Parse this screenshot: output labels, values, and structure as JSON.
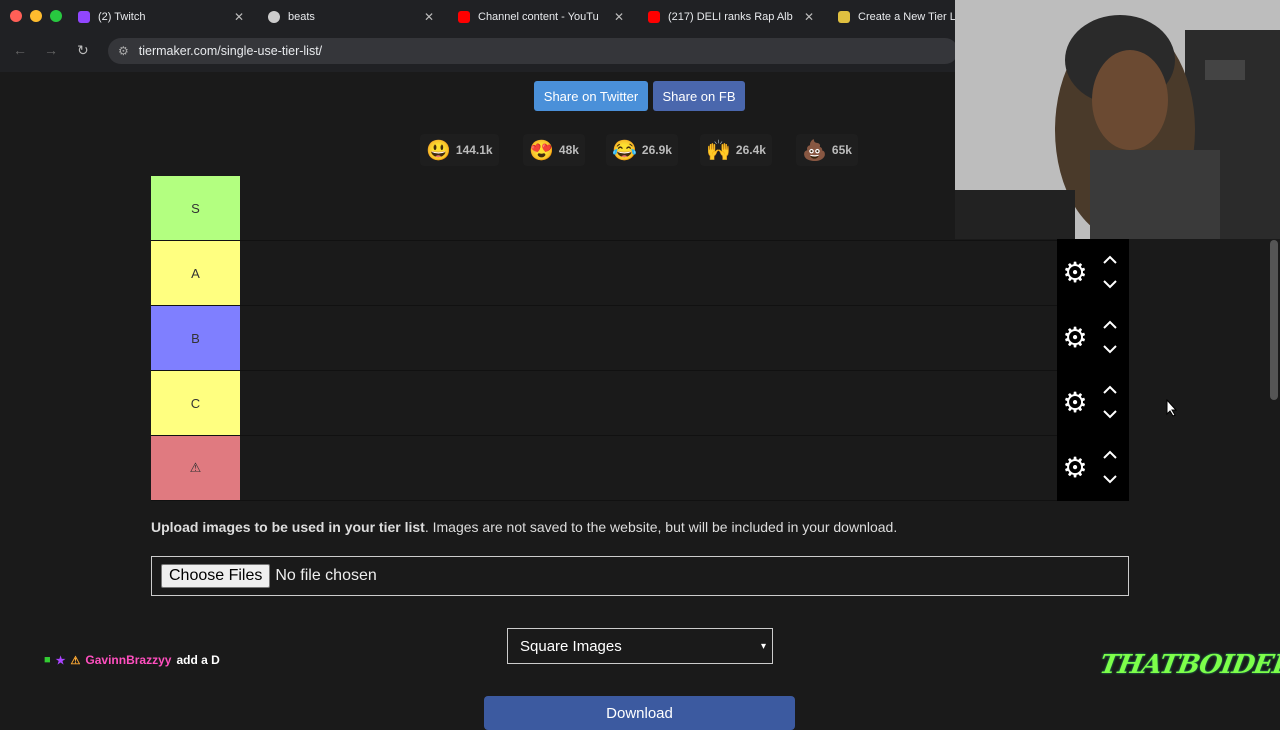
{
  "tabs": [
    {
      "label": "(2) Twitch",
      "icon": "twitch-icon",
      "color": "#9146ff"
    },
    {
      "label": "beats",
      "icon": "disc-icon",
      "color": "#cccccc"
    },
    {
      "label": "Channel content - YouTu",
      "icon": "youtube-icon",
      "color": "#ff0000"
    },
    {
      "label": "(217) DELI ranks Rap Alb",
      "icon": "youtube-icon",
      "color": "#ff0000"
    },
    {
      "label": "Create a New Tier L",
      "icon": "tiermaker-icon",
      "color": "#e0c040"
    }
  ],
  "address": "tiermaker.com/single-use-tier-list/",
  "share": {
    "twitter": "Share on Twitter",
    "fb": "Share on FB"
  },
  "reactions": [
    {
      "emoji": "😃",
      "count": "144.1k"
    },
    {
      "emoji": "😍",
      "count": "48k"
    },
    {
      "emoji": "😂",
      "count": "26.9k"
    },
    {
      "emoji": "🙌",
      "count": "26.4k"
    },
    {
      "emoji": "💩",
      "count": "65k"
    }
  ],
  "tiers": [
    {
      "label": "S",
      "color": "#b3ff80"
    },
    {
      "label": "A",
      "color": "#ffff80"
    },
    {
      "label": "B",
      "color": "#7f7fff"
    },
    {
      "label": "C",
      "color": "#ffff80"
    },
    {
      "label": "⚠",
      "color": "#e07a80"
    }
  ],
  "upload": {
    "bold": "Upload images to be used in your tier list",
    "rest": ". Images are not saved to the website, but will be included in your download."
  },
  "file": {
    "button": "Choose Files",
    "status": "No file chosen"
  },
  "select": {
    "value": "Square Images"
  },
  "download": "Download",
  "chat": {
    "user": "GavinnBrazzyy",
    "message": "add a D"
  },
  "overlay_logo": "THATBOIDELI"
}
